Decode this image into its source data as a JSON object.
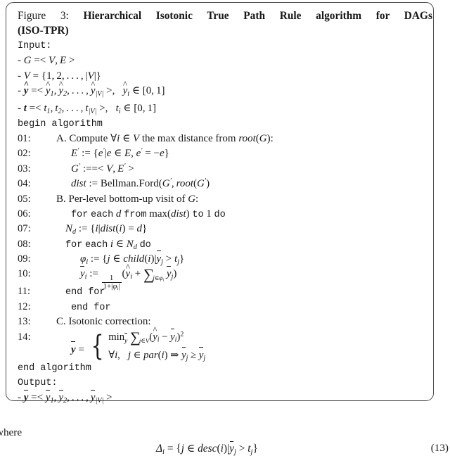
{
  "figure": {
    "caption_label": "Figure 3:",
    "caption_title_line1": "Hierarchical Isotonic True Path Rule algorithm for DAGs",
    "caption_title_line2": "(ISO-TPR)",
    "input_header": "Input:",
    "inputs": [
      {
        "dash": "-",
        "symbol": "G",
        "body": "=< V, E >"
      },
      {
        "dash": "-",
        "symbol": "V",
        "body": "= {1, 2, ... , |V|}"
      },
      {
        "dash": "-",
        "symbol": "y-hat-bold",
        "body": "=< ŷ1, ŷ2, ... , ŷ|V| >,   ŷi ∈ [0, 1]"
      },
      {
        "dash": "-",
        "symbol": "t-bold",
        "body": "=< t1, t2, ... , t|V| >,   ti ∈ [0, 1]"
      }
    ],
    "begin_keyword": "begin algorithm",
    "end_keyword": "end algorithm",
    "output_header": "Output:",
    "output_line": "- ȳ =< ȳ1, ȳ2, ... , ȳ|V| >",
    "steps": [
      {
        "num": "01:",
        "text": "A. Compute ∀i ∈ V the max distance from root(G):"
      },
      {
        "num": "02:",
        "text": "E′ := {e′|e ∈ E, e′ = −e}"
      },
      {
        "num": "03:",
        "text": "G′ :=< V, E′ >"
      },
      {
        "num": "04:",
        "text": "dist := Bellman.Ford(G′, root(G′))"
      },
      {
        "num": "05:",
        "text": "B. Per-level bottom-up visit of G:"
      },
      {
        "num": "06:",
        "text": "for each d from max(dist) to 1 do"
      },
      {
        "num": "07:",
        "text": "Nd := {i|dist(i) = d}"
      },
      {
        "num": "08:",
        "text": "for each i ∈ Nd do"
      },
      {
        "num": "09:",
        "text": "ϕi := {j ∈ child(i)|ȳj > tj}"
      },
      {
        "num": "10:",
        "text": "ȳi := 1/(1+|ϕi|)(ŷi + ∑ j∈ϕi ȳj)"
      },
      {
        "num": "11:",
        "text": "end for"
      },
      {
        "num": "12:",
        "text": "end for"
      },
      {
        "num": "13:",
        "text": "C. Isotonic correction:"
      },
      {
        "num": "14:",
        "text": "ȳ = { minȳ ∑i∈V (ŷi − ȳi)² ; ∀i,  j ∈ par(i) ⇒ ȳj ≥ ȳj }"
      }
    ],
    "tokens": {
      "for": "for",
      "each": "each",
      "from": "from",
      "to": "to",
      "do": "do",
      "one": "1",
      "end_for": "end for",
      "A_label": "A.",
      "A_text_1": "Compute",
      "A_text_2": "the max distance from",
      "A_colon": ":",
      "B_label": "B.",
      "B_text": "Per-level bottom-up visit of",
      "C_label": "C.",
      "C_text": "Isotonic correction:",
      "assign": ":=",
      "bellman": "Bellman.Ford",
      "max": "max",
      "min": "min",
      "dist": "dist",
      "child": "child",
      "par": "par",
      "root": "root",
      "desc": "desc"
    }
  },
  "body_text": {
    "where": "where",
    "equation_number": "(13)",
    "equation": "Δi = {j ∈ desc(i)|ȳj > tj}"
  },
  "colors": {
    "text": "#181818",
    "border": "#4a4a4a",
    "background": "#ffffff"
  }
}
